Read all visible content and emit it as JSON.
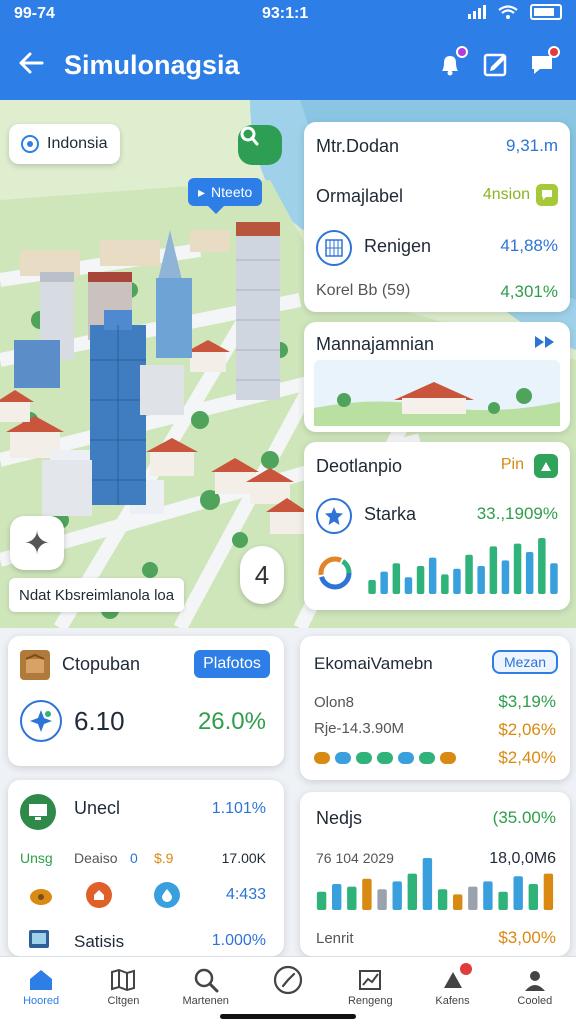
{
  "status_bar": {
    "time": "99-74",
    "center_text": "93:1:1"
  },
  "app_bar": {
    "title": "Simulonagsia"
  },
  "map": {
    "location_chip": "Indonsia",
    "pin_label": "Nteeto",
    "caption": "Ndat Kbsreimlanola loa"
  },
  "stats_card": {
    "header": "Mtr.Dodan",
    "header_value": "9,31.m",
    "row1_label": "Ormajlabel",
    "row1_value": "4nsion",
    "row2_label": "Renigen",
    "row2_value": "41,88%",
    "row3_label": "Korel Bb (59)",
    "row3_value": "4,301%"
  },
  "management_card": {
    "title": "Mannajamnian"
  },
  "development_card": {
    "title": "Deotlanpio",
    "title_value": "Pin",
    "row_label": "Starka",
    "row_value": "33.,1909%",
    "bars": [
      0.25,
      0.4,
      0.55,
      0.3,
      0.5,
      0.65,
      0.35,
      0.45,
      0.7,
      0.5,
      0.85,
      0.6,
      0.9,
      0.75,
      1.0,
      0.55
    ],
    "colors": {
      "bar_green": "#2fb37a",
      "bar_blue": "#3aa0dd"
    }
  },
  "cp_card": {
    "title": "Ctopuban",
    "badge": "Plafotos",
    "value": "6.10",
    "percent": "26.0%"
  },
  "eco_card": {
    "title": "EkomaiVamebn",
    "badge": "Mezan",
    "row1_label": "Olon8",
    "row1_value": "$3,19%",
    "row2_label": "Rje-14.3.90M",
    "row2_value": "$2,06%",
    "row3_value": "$2,40%"
  },
  "u_card": {
    "title": "Unecl",
    "title_value": "1.101%",
    "row1_a": "Unsg",
    "row1_b": "Deaiso",
    "row1_c": "0",
    "row1_d": "$.9",
    "row1_e": "17.00K",
    "row2_value": "4:433",
    "row3_label": "Satisis",
    "row3_value": "1.000%"
  },
  "n_card": {
    "title": "Nedjs",
    "title_value": "(35.00%",
    "sub_label": "76 104 2029",
    "sub_value": "18,0,0M6",
    "footer_label": "Lenrit",
    "footer_value": "$3,00%",
    "bars": [
      0.35,
      0.5,
      0.45,
      0.6,
      0.4,
      0.55,
      0.7,
      1.0,
      0.4,
      0.3,
      0.45,
      0.55,
      0.35,
      0.65,
      0.5,
      0.7
    ]
  },
  "nav": {
    "items": [
      {
        "label": "Hoored",
        "icon": "home-icon"
      },
      {
        "label": "Cltgen",
        "icon": "map-icon"
      },
      {
        "label": "Martenen",
        "icon": "search-icon"
      },
      {
        "label": "",
        "icon": "clock-icon"
      },
      {
        "label": "Rengeng",
        "icon": "chart-icon"
      },
      {
        "label": "Kafens",
        "icon": "alert-icon"
      },
      {
        "label": "Cooled",
        "icon": "profile-icon"
      }
    ]
  }
}
